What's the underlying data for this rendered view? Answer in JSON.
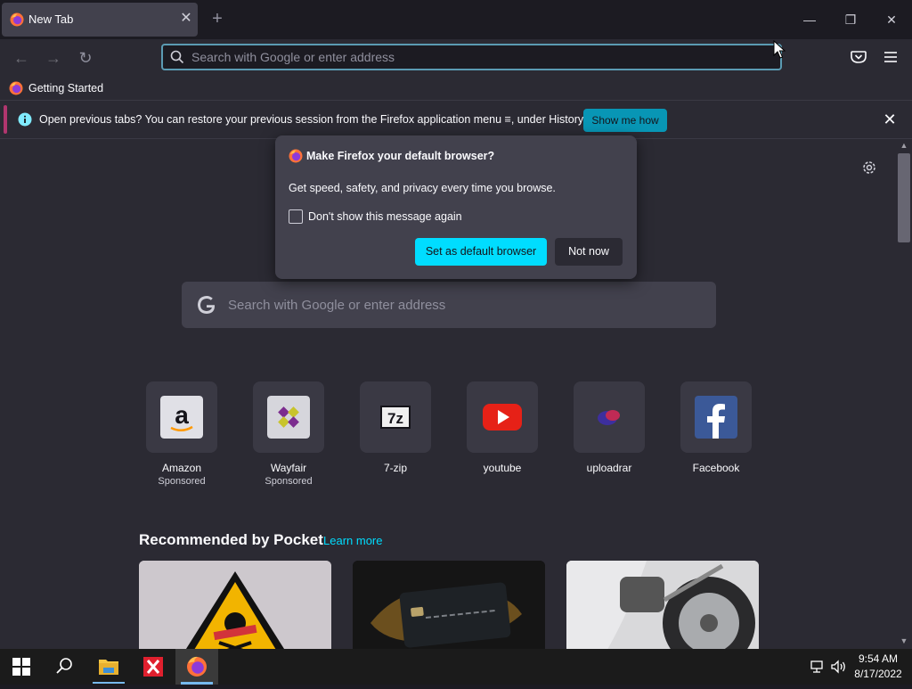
{
  "tab": {
    "title": "New Tab",
    "close": "✕",
    "new_tab": "+"
  },
  "window_controls": {
    "minimize": "—",
    "maximize": "❐",
    "close": "✕"
  },
  "nav": {
    "back": "←",
    "forward": "→",
    "reload": "↻",
    "url_placeholder": "Search with Google or enter address"
  },
  "bookmarks": [
    {
      "label": "Getting Started"
    }
  ],
  "notification": {
    "strong": "Open previous tabs?",
    "text": " You can restore your previous session from the Firefox application menu ",
    "menu_glyph": "≡",
    "text_end": ", under History.",
    "button": "Show me how",
    "close": "✕"
  },
  "doorhanger": {
    "title": "Make Firefox your default browser?",
    "body": "Get speed, safety, and privacy every time you browse.",
    "checkbox_label": "Don't show this message again",
    "checkbox_checked": false,
    "primary_button": "Set as default browser",
    "secondary_button": "Not now"
  },
  "search": {
    "placeholder": "Search with Google or enter address"
  },
  "top_sites": [
    {
      "name": "Amazon",
      "sponsored": "Sponsored",
      "icon": "amazon-icon"
    },
    {
      "name": "Wayfair",
      "sponsored": "Sponsored",
      "icon": "wayfair-icon"
    },
    {
      "name": "7-zip",
      "sponsored": "",
      "icon": "7zip-icon"
    },
    {
      "name": "youtube",
      "sponsored": "",
      "icon": "youtube-icon"
    },
    {
      "name": "uploadrar",
      "sponsored": "",
      "icon": "uploadrar-icon"
    },
    {
      "name": "Facebook",
      "sponsored": "",
      "icon": "facebook-icon"
    }
  ],
  "pocket": {
    "title": "Recommended by Pocket",
    "learn_more": "Learn more"
  },
  "taskbar": {
    "time": "9:54 AM",
    "date": "8/17/2022"
  },
  "colors": {
    "accent": "#00ddff",
    "notify_button": "#0896b5",
    "urlbar_focus": "#5b9bb3"
  }
}
